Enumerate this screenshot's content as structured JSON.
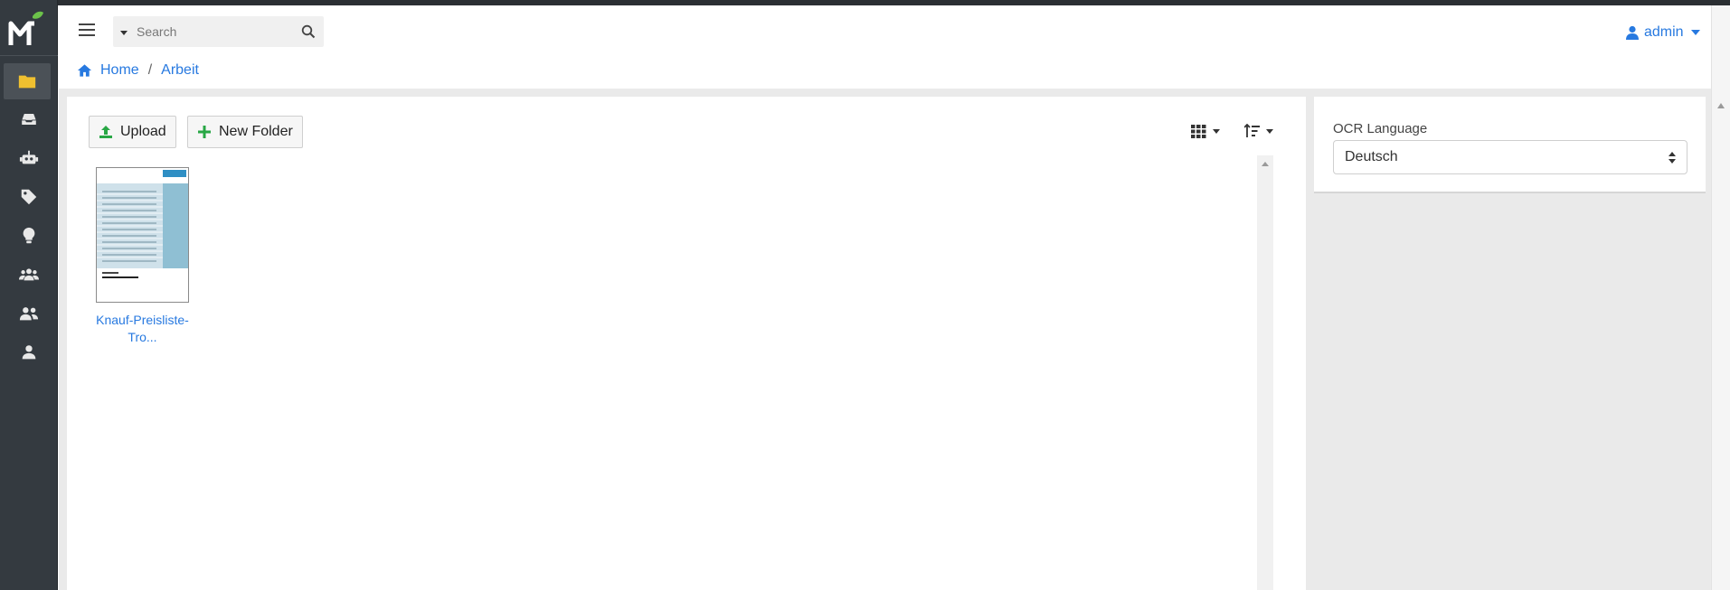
{
  "app": {
    "name": "Mayan-style document manager",
    "accent": "#2779e0",
    "sidebar_bg": "#343a40"
  },
  "sidebar": {
    "items": [
      {
        "icon": "folder-icon",
        "active": true
      },
      {
        "icon": "inbox-icon",
        "active": false
      },
      {
        "icon": "robot-icon",
        "active": false
      },
      {
        "icon": "tag-icon",
        "active": false
      },
      {
        "icon": "lightbulb-icon",
        "active": false
      },
      {
        "icon": "users-group-icon",
        "active": false
      },
      {
        "icon": "user-friends-icon",
        "active": false
      },
      {
        "icon": "user-icon",
        "active": false
      }
    ]
  },
  "topbar": {
    "search_placeholder": "Search",
    "user": "admin"
  },
  "breadcrumb": {
    "home": "Home",
    "separator": "/",
    "current": "Arbeit"
  },
  "toolbar": {
    "upload_label": "Upload",
    "new_folder_label": "New Folder"
  },
  "files": [
    {
      "name_line1": "Knauf-Preisliste-",
      "name_line2": "Tro..."
    }
  ],
  "panel": {
    "ocr_label": "OCR Language",
    "ocr_value": "Deutsch"
  }
}
